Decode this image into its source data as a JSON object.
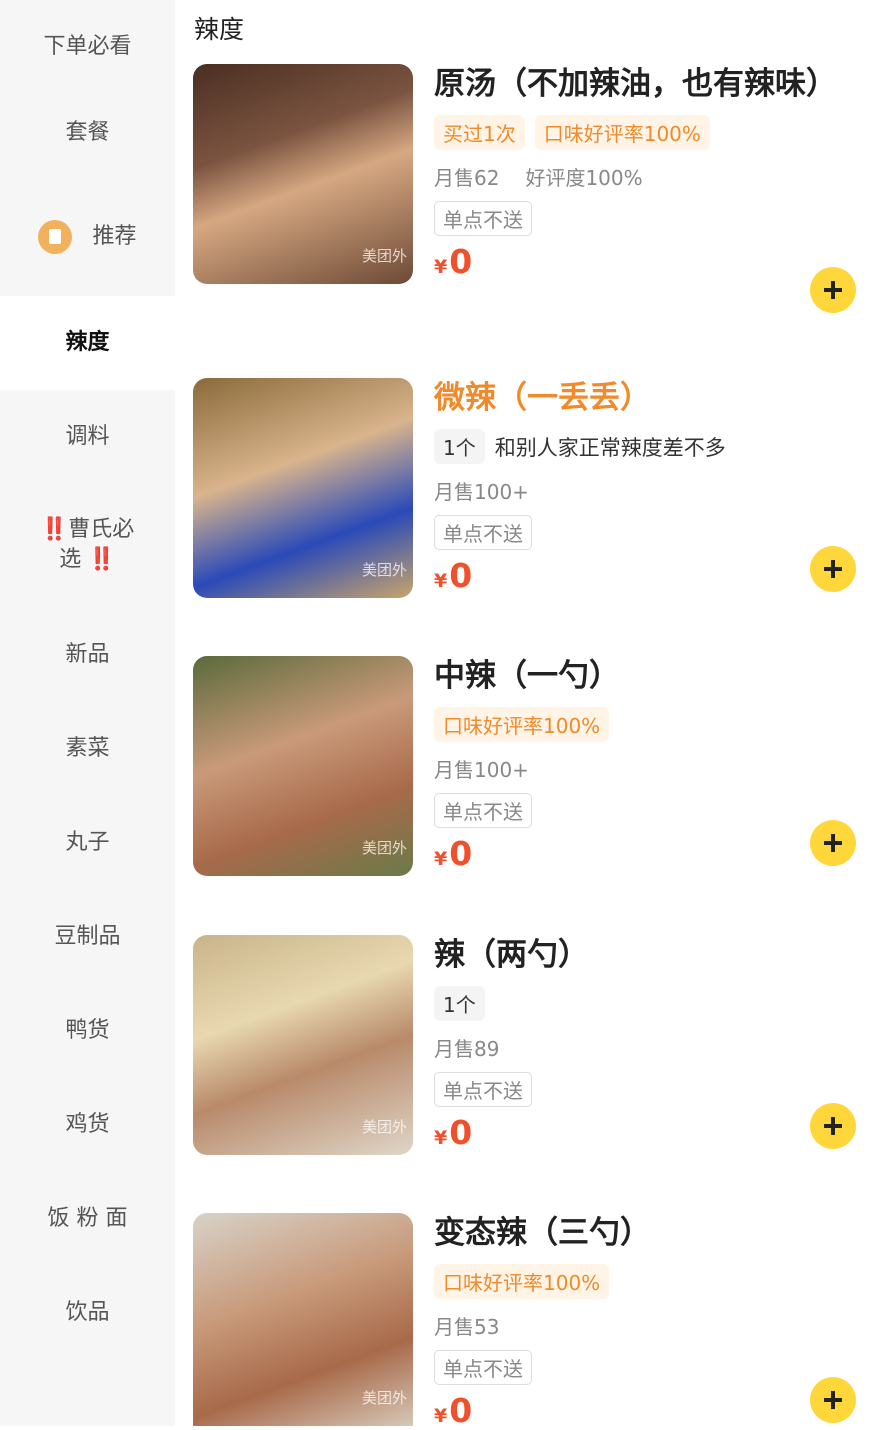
{
  "sidebar": {
    "items": [
      {
        "label": "下单必看"
      },
      {
        "label": "套餐"
      },
      {
        "label": "推荐"
      },
      {
        "label": "辣度"
      },
      {
        "label": "调料"
      },
      {
        "label_line1": "曹氏必",
        "label_line2": "选",
        "bang": "‼️"
      },
      {
        "label": "新品"
      },
      {
        "label": "素菜"
      },
      {
        "label": "丸子"
      },
      {
        "label": "豆制品"
      },
      {
        "label": "鸭货"
      },
      {
        "label": "鸡货"
      },
      {
        "label": "饭 粉 面"
      },
      {
        "label": "饮品"
      }
    ]
  },
  "main": {
    "section_title": "辣度",
    "watermark": "美团外",
    "currency": "¥",
    "no_send": "单点不送",
    "products": [
      {
        "name": "原汤（不加辣油，也有辣味）",
        "tags": [
          "买过1次",
          "口味好评率100%"
        ],
        "sales": "月售62",
        "rating": "好评度100%",
        "price": "0"
      },
      {
        "name": "微辣（一丢丢）",
        "qty": "1个",
        "desc": "和别人家正常辣度差不多",
        "sales": "月售100+",
        "price": "0"
      },
      {
        "name": "中辣（一勺）",
        "tags": [
          "口味好评率100%"
        ],
        "sales": "月售100+",
        "price": "0"
      },
      {
        "name": "辣（两勺）",
        "qty": "1个",
        "sales": "月售89",
        "price": "0"
      },
      {
        "name": "变态辣（三勺）",
        "tags": [
          "口味好评率100%"
        ],
        "sales": "月售53",
        "price": "0"
      }
    ]
  },
  "colors": {
    "accent_orange": "#f08a2a",
    "price_red": "#f0502a",
    "add_button_yellow": "#ffd73a",
    "sidebar_bg": "#f6f6f6"
  }
}
